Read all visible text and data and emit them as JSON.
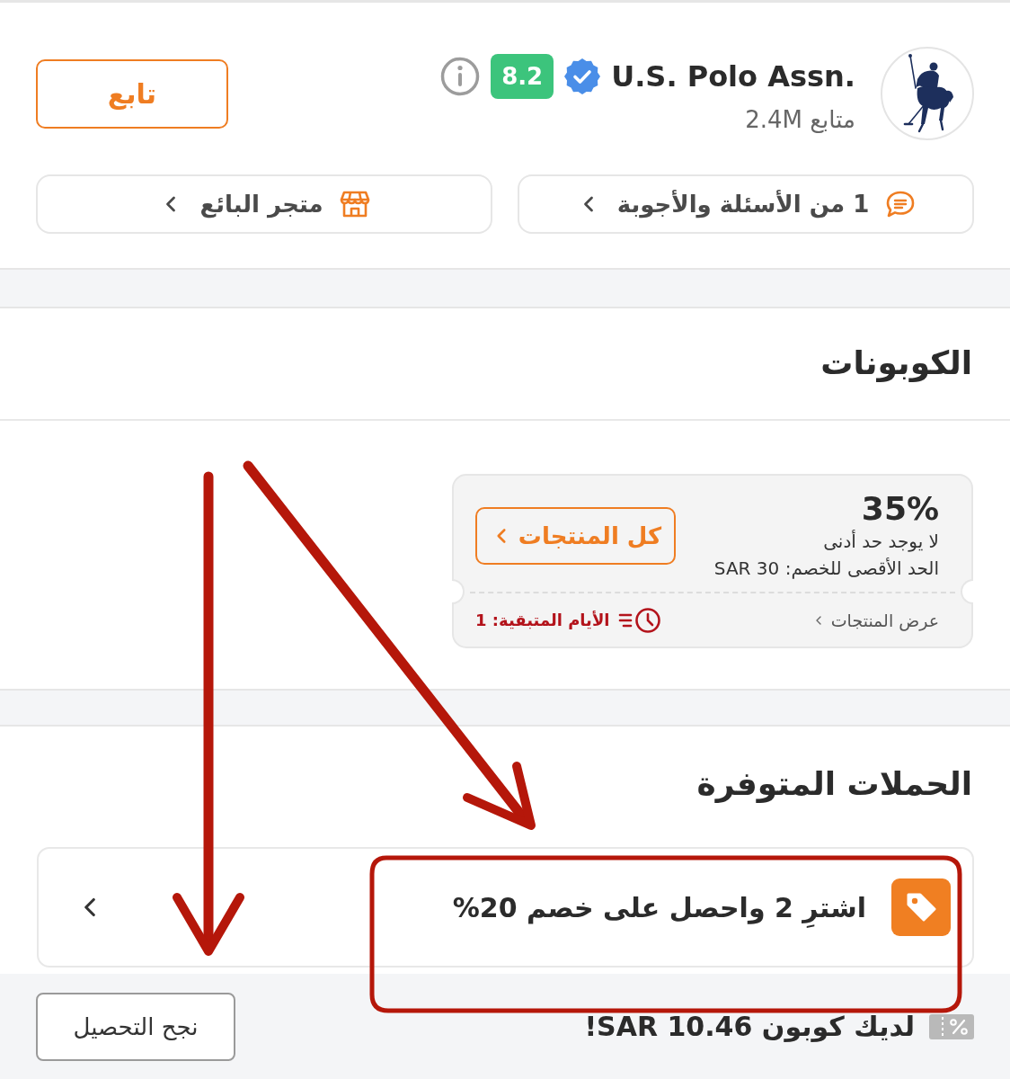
{
  "seller": {
    "name": "U.S. Polo Assn.",
    "verified": true,
    "score": "8.2",
    "followers": "متابع 2.4M",
    "follow_button": "تابع"
  },
  "links": [
    {
      "kind": "questions",
      "label": "1 من الأسئلة والأجوبة"
    },
    {
      "kind": "store",
      "label": "متجر البائع"
    }
  ],
  "coupons": {
    "title": "الكوبونات",
    "items": [
      {
        "discount": "35%",
        "minimum": "لا يوجد حد أدنى",
        "maximum": "الحد الأقصى للخصم: SAR 30",
        "button": "كل المنتجات",
        "link": "عرض المنتجات",
        "remaining": "الأيام المتبقية: 1"
      }
    ]
  },
  "campaigns": {
    "title": "الحملات المتوفرة",
    "items": [
      {
        "label": "اشترِ 2 واحصل على خصم 20%"
      }
    ]
  },
  "bottom_bar": {
    "message": "لديك كوبون SAR 10.46!",
    "button": "نجح التحصيل"
  },
  "annotations": [
    {
      "kind": "arrow"
    },
    {
      "kind": "arrow"
    },
    {
      "kind": "frame"
    }
  ]
}
